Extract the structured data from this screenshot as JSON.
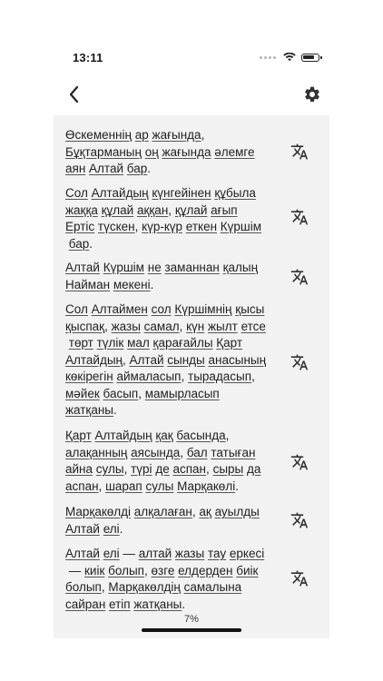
{
  "status": {
    "time": "13:11"
  },
  "nav": {
    "back_icon": "chevron-left-icon",
    "settings_icon": "gear-icon"
  },
  "paragraphs": [
    {
      "lines": [
        [
          "Өскеменнің",
          " ",
          "ар",
          " ",
          "жағында",
          ","
        ],
        [
          "Бұқтарманың",
          " ",
          "оң",
          " ",
          "жағында",
          " ",
          "әлемге"
        ],
        [
          "аян",
          " ",
          "Алтай",
          " ",
          "бар",
          "."
        ]
      ]
    },
    {
      "lines": [
        [
          "Сол",
          " ",
          "Алтайдың",
          " ",
          "күнгейінен",
          " ",
          "құбыла"
        ],
        [
          "жаққа",
          " ",
          "құлай",
          " ",
          "аққан",
          ",",
          " ",
          "құлай",
          " ",
          "ағып"
        ],
        [
          "Ертіс",
          " ",
          "түскен",
          ",",
          " ",
          "күр-күр",
          " ",
          "еткен",
          " ",
          "Күршім"
        ],
        [
          " ",
          "бар",
          "."
        ]
      ]
    },
    {
      "lines": [
        [
          "Алтай",
          " ",
          "Күршім",
          " ",
          "не",
          " ",
          "заманнан",
          " ",
          "қалың"
        ],
        [
          "Найман",
          " ",
          "мекені",
          "."
        ]
      ]
    },
    {
      "lines": [
        [
          "Сол",
          " ",
          "Алтаймен",
          " ",
          "сол",
          " ",
          "Күршімнің",
          " ",
          "қысы"
        ],
        [
          "қыспақ",
          ",",
          " ",
          "жазы",
          " ",
          "самал",
          ",",
          " ",
          "күн",
          " ",
          "жылт",
          " ",
          "етсе"
        ],
        [
          " ",
          "төрт",
          " ",
          "түлік",
          " ",
          "мал",
          " ",
          "қарағайлы",
          " ",
          "Қарт"
        ],
        [
          "Алтайдың",
          ",",
          " ",
          "Алтай",
          " ",
          "сынды",
          " ",
          "анасының"
        ],
        [
          "көкірегін",
          " ",
          "аймаласып",
          ",",
          " ",
          "тырадасып",
          ","
        ],
        [
          "мәйек",
          " ",
          "басып",
          ",",
          " ",
          "мамырласып"
        ],
        [
          "жатқаны",
          "."
        ]
      ]
    },
    {
      "lines": [
        [
          "Қарт",
          " ",
          "Алтайдың",
          " ",
          "қақ",
          " ",
          "басында",
          ","
        ],
        [
          "алақанның",
          " ",
          "аясында",
          ",",
          " ",
          "бал",
          " ",
          "татыған"
        ],
        [
          "айна",
          " ",
          "сулы",
          ",",
          " ",
          "түрі",
          " ",
          "де",
          " ",
          "аспан",
          ",",
          " ",
          "сыры",
          " ",
          "да"
        ],
        [
          "аспан",
          ",",
          " ",
          "шарап",
          " ",
          "сулы",
          " ",
          "Марқакөлі",
          "."
        ]
      ]
    },
    {
      "lines": [
        [
          "Марқакөлді",
          " ",
          "алқалаған",
          ",",
          " ",
          "ақ",
          " ",
          "ауылды"
        ],
        [
          "Алтай",
          " ",
          "елі",
          "."
        ]
      ]
    },
    {
      "lines": [
        [
          "Алтай",
          " ",
          "елі",
          " — ",
          "алтай",
          " ",
          "жазы",
          " ",
          "тау",
          " ",
          "еркесі"
        ],
        [
          " — ",
          "киік",
          " ",
          "болып",
          ",",
          " ",
          "өзге",
          " ",
          "елдерден",
          " ",
          "биік"
        ],
        [
          "болып",
          ",",
          " ",
          "Марқакөлдің",
          " ",
          "самалына"
        ],
        [
          "сайран",
          " ",
          "етіп",
          " ",
          "жатқаны",
          "."
        ]
      ]
    }
  ],
  "progress": {
    "label": "7%",
    "value": 0.07
  }
}
